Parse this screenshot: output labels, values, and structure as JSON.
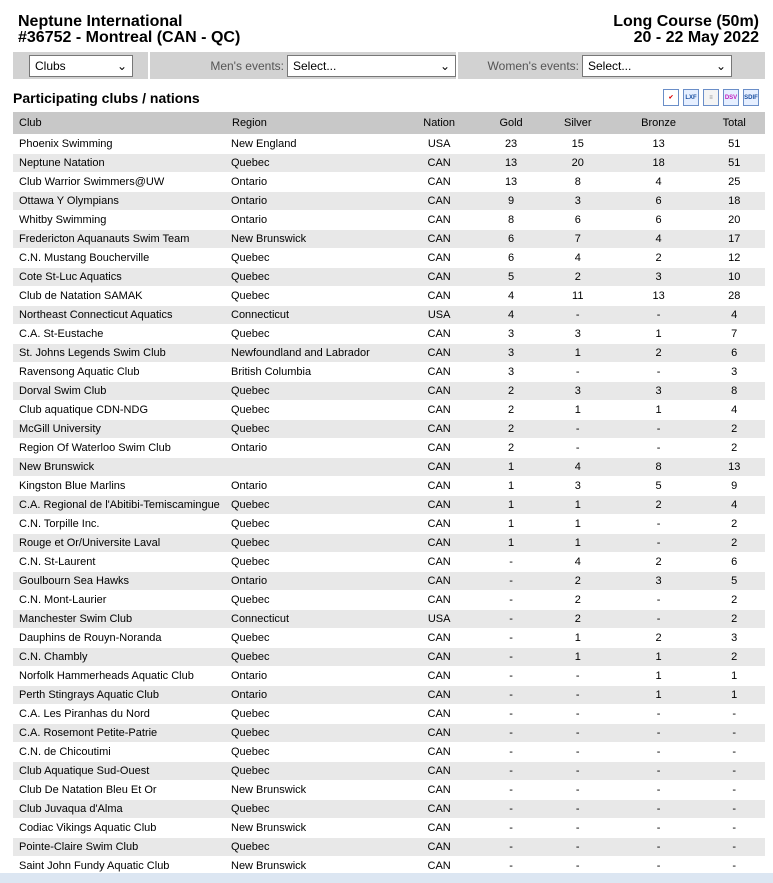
{
  "header": {
    "title": "Neptune International",
    "subtitle": "#36752 - Montreal (CAN - QC)",
    "course": "Long Course (50m)",
    "dates": "20 - 22 May 2022"
  },
  "filters": {
    "view": "Clubs",
    "mens_label": "Men's events:",
    "mens_value": "Select...",
    "womens_label": "Women's events:",
    "womens_value": "Select..."
  },
  "section_title": "Participating clubs / nations",
  "export_icons": [
    "check",
    "LXF",
    "list",
    "DSV",
    "SDIF"
  ],
  "columns": [
    "Club",
    "Region",
    "Nation",
    "Gold",
    "Silver",
    "Bronze",
    "Total"
  ],
  "rows": [
    [
      "Phoenix Swimming",
      "New England",
      "USA",
      "23",
      "15",
      "13",
      "51"
    ],
    [
      "Neptune Natation",
      "Quebec",
      "CAN",
      "13",
      "20",
      "18",
      "51"
    ],
    [
      "Club Warrior Swimmers@UW",
      "Ontario",
      "CAN",
      "13",
      "8",
      "4",
      "25"
    ],
    [
      "Ottawa Y Olympians",
      "Ontario",
      "CAN",
      "9",
      "3",
      "6",
      "18"
    ],
    [
      "Whitby Swimming",
      "Ontario",
      "CAN",
      "8",
      "6",
      "6",
      "20"
    ],
    [
      "Fredericton Aquanauts Swim Team",
      "New Brunswick",
      "CAN",
      "6",
      "7",
      "4",
      "17"
    ],
    [
      "C.N. Mustang Boucherville",
      "Quebec",
      "CAN",
      "6",
      "4",
      "2",
      "12"
    ],
    [
      "Cote St-Luc Aquatics",
      "Quebec",
      "CAN",
      "5",
      "2",
      "3",
      "10"
    ],
    [
      "Club de Natation SAMAK",
      "Quebec",
      "CAN",
      "4",
      "11",
      "13",
      "28"
    ],
    [
      "Northeast Connecticut Aquatics",
      "Connecticut",
      "USA",
      "4",
      "-",
      "-",
      "4"
    ],
    [
      "C.A. St-Eustache",
      "Quebec",
      "CAN",
      "3",
      "3",
      "1",
      "7"
    ],
    [
      "St. Johns Legends Swim Club",
      "Newfoundland and Labrador",
      "CAN",
      "3",
      "1",
      "2",
      "6"
    ],
    [
      "Ravensong Aquatic Club",
      "British Columbia",
      "CAN",
      "3",
      "-",
      "-",
      "3"
    ],
    [
      "Dorval Swim Club",
      "Quebec",
      "CAN",
      "2",
      "3",
      "3",
      "8"
    ],
    [
      "Club aquatique CDN-NDG",
      "Quebec",
      "CAN",
      "2",
      "1",
      "1",
      "4"
    ],
    [
      "McGill University",
      "Quebec",
      "CAN",
      "2",
      "-",
      "-",
      "2"
    ],
    [
      "Region Of Waterloo Swim Club",
      "Ontario",
      "CAN",
      "2",
      "-",
      "-",
      "2"
    ],
    [
      "New Brunswick",
      "",
      "CAN",
      "1",
      "4",
      "8",
      "13"
    ],
    [
      "Kingston Blue Marlins",
      "Ontario",
      "CAN",
      "1",
      "3",
      "5",
      "9"
    ],
    [
      "C.A. Regional de l'Abitibi-Temiscamingue",
      "Quebec",
      "CAN",
      "1",
      "1",
      "2",
      "4"
    ],
    [
      "C.N. Torpille Inc.",
      "Quebec",
      "CAN",
      "1",
      "1",
      "-",
      "2"
    ],
    [
      "Rouge et Or/Universite Laval",
      "Quebec",
      "CAN",
      "1",
      "1",
      "-",
      "2"
    ],
    [
      "C.N. St-Laurent",
      "Quebec",
      "CAN",
      "-",
      "4",
      "2",
      "6"
    ],
    [
      "Goulbourn Sea Hawks",
      "Ontario",
      "CAN",
      "-",
      "2",
      "3",
      "5"
    ],
    [
      "C.N. Mont-Laurier",
      "Quebec",
      "CAN",
      "-",
      "2",
      "-",
      "2"
    ],
    [
      "Manchester Swim Club",
      "Connecticut",
      "USA",
      "-",
      "2",
      "-",
      "2"
    ],
    [
      "Dauphins de Rouyn-Noranda",
      "Quebec",
      "CAN",
      "-",
      "1",
      "2",
      "3"
    ],
    [
      "C.N. Chambly",
      "Quebec",
      "CAN",
      "-",
      "1",
      "1",
      "2"
    ],
    [
      "Norfolk Hammerheads Aquatic Club",
      "Ontario",
      "CAN",
      "-",
      "-",
      "1",
      "1"
    ],
    [
      "Perth Stingrays Aquatic Club",
      "Ontario",
      "CAN",
      "-",
      "-",
      "1",
      "1"
    ],
    [
      "C.A. Les Piranhas du Nord",
      "Quebec",
      "CAN",
      "-",
      "-",
      "-",
      "-"
    ],
    [
      "C.A. Rosemont Petite-Patrie",
      "Quebec",
      "CAN",
      "-",
      "-",
      "-",
      "-"
    ],
    [
      "C.N. de Chicoutimi",
      "Quebec",
      "CAN",
      "-",
      "-",
      "-",
      "-"
    ],
    [
      "Club Aquatique Sud-Ouest",
      "Quebec",
      "CAN",
      "-",
      "-",
      "-",
      "-"
    ],
    [
      "Club De Natation Bleu Et Or",
      "New Brunswick",
      "CAN",
      "-",
      "-",
      "-",
      "-"
    ],
    [
      "Club Juvaqua d'Alma",
      "Quebec",
      "CAN",
      "-",
      "-",
      "-",
      "-"
    ],
    [
      "Codiac Vikings Aquatic Club",
      "New Brunswick",
      "CAN",
      "-",
      "-",
      "-",
      "-"
    ],
    [
      "Pointe-Claire Swim Club",
      "Quebec",
      "CAN",
      "-",
      "-",
      "-",
      "-"
    ],
    [
      "Saint John Fundy Aquatic Club",
      "New Brunswick",
      "CAN",
      "-",
      "-",
      "-",
      "-"
    ]
  ]
}
